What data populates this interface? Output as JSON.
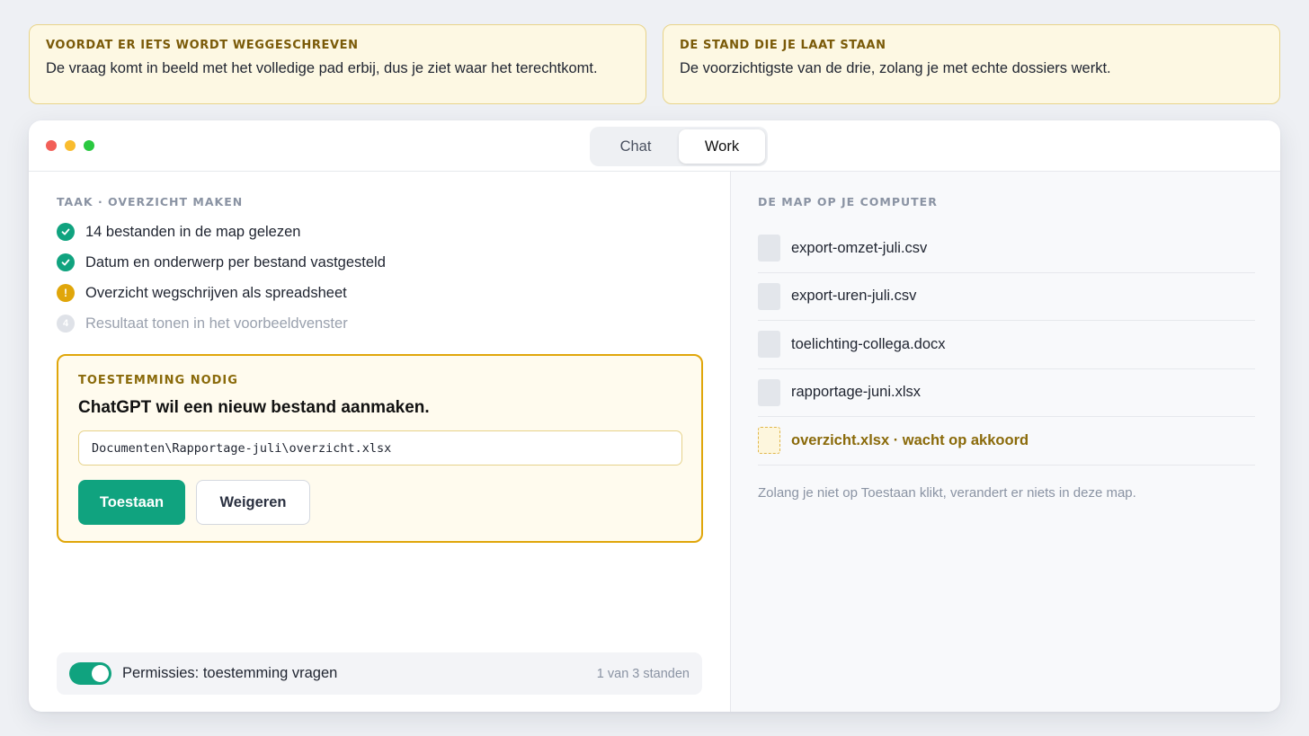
{
  "callouts": [
    {
      "title": "Voordat er iets wordt weggeschreven",
      "text": "De vraag komt in beeld met het volledige pad erbij, dus je ziet waar het terechtkomt."
    },
    {
      "title": "De stand die je laat staan",
      "text": "De voorzichtigste van de drie, zolang je met echte dossiers werkt."
    }
  ],
  "window": {
    "tabs": [
      {
        "label": "Chat",
        "active": false
      },
      {
        "label": "Work",
        "active": true
      }
    ]
  },
  "task": {
    "section_label": "Taak · overzicht maken",
    "steps": [
      {
        "label": "14 bestanden in de map gelezen",
        "status": "done",
        "icon": "check-icon"
      },
      {
        "label": "Datum en onderwerp per bestand vastgesteld",
        "status": "done",
        "icon": "check-icon"
      },
      {
        "label": "Overzicht wegschrijven als spreadsheet",
        "status": "warning",
        "icon": "!"
      },
      {
        "label": "Resultaat tonen in het voorbeeldvenster",
        "status": "pending",
        "icon": "4"
      }
    ]
  },
  "permission": {
    "label": "Toestemming nodig",
    "title": "ChatGPT wil een nieuw bestand aanmaken.",
    "path": "Documenten\\Rapportage-juli\\overzicht.xlsx",
    "allow_label": "Toestaan",
    "deny_label": "Weigeren"
  },
  "footer": {
    "toggle_on": true,
    "label": "Permissies: toestemming vragen",
    "count": "1 van 3 standen"
  },
  "folder": {
    "section_label": "De map op je computer",
    "files": [
      {
        "name": "export-omzet-juli.csv",
        "pending": false
      },
      {
        "name": "export-uren-juli.csv",
        "pending": false
      },
      {
        "name": "toelichting-collega.docx",
        "pending": false
      },
      {
        "name": "rapportage-juni.xlsx",
        "pending": false
      },
      {
        "name": "overzicht.xlsx · wacht op akkoord",
        "pending": true
      }
    ],
    "note": "Zolang je niet op Toestaan klikt, verandert er niets in deze map."
  },
  "colors": {
    "accent": "#10a37f",
    "warning": "#e0a60a",
    "callout_bg": "#fdf8e3"
  }
}
